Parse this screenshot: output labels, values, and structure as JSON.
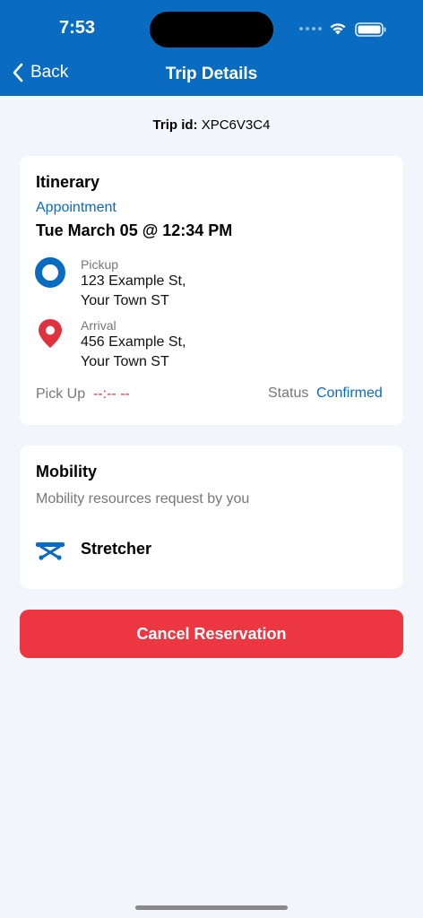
{
  "status_bar": {
    "time": "7:53"
  },
  "nav": {
    "back_label": "Back",
    "title": "Trip Details"
  },
  "trip": {
    "id_label": "Trip id:",
    "id_value": "XPC6V3C4"
  },
  "itinerary": {
    "title": "Itinerary",
    "appointment_label": "Appointment",
    "appointment_time": "Tue March 05 @ 12:34 PM",
    "pickup": {
      "label": "Pickup",
      "line1": "123 Example St,",
      "line2": "Your Town ST"
    },
    "arrival": {
      "label": "Arrival",
      "line1": "456 Example St,",
      "line2": "Your Town ST"
    },
    "pickup_time_label": "Pick Up",
    "pickup_time_value": "--:-- --",
    "status_label": "Status",
    "status_value": "Confirmed"
  },
  "mobility": {
    "title": "Mobility",
    "subtitle": "Mobility resources request by you",
    "resource": "Stretcher"
  },
  "actions": {
    "cancel_label": "Cancel Reservation"
  },
  "colors": {
    "primary": "#0a6cc0",
    "danger": "#ec3743",
    "arrival_pin": "#e0323e"
  }
}
